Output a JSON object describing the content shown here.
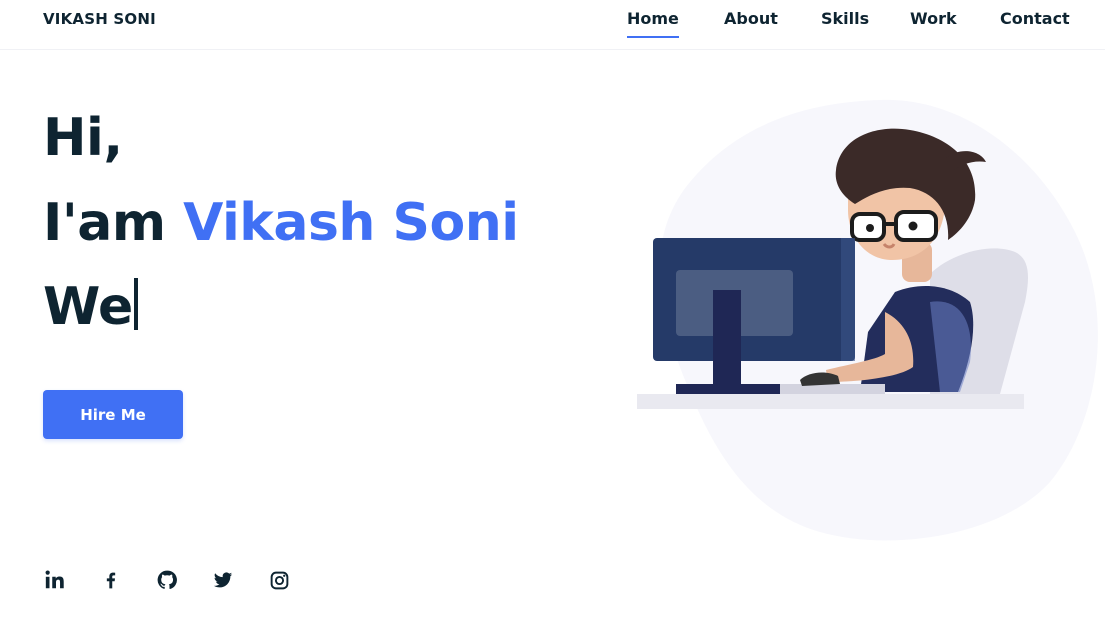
{
  "header": {
    "logo": "VIKASH SONI",
    "nav": [
      {
        "label": "Home",
        "active": true
      },
      {
        "label": "About",
        "active": false
      },
      {
        "label": "Skills",
        "active": false
      },
      {
        "label": "Work",
        "active": false
      },
      {
        "label": "Contact",
        "active": false
      }
    ]
  },
  "hero": {
    "greeting": "Hi,",
    "intro_prefix": "I'am ",
    "name": "Vikash Soni",
    "typed_text": "We",
    "cta_label": "Hire Me"
  },
  "socials": [
    {
      "icon": "linkedin-icon"
    },
    {
      "icon": "facebook-icon"
    },
    {
      "icon": "github-icon"
    },
    {
      "icon": "twitter-icon"
    },
    {
      "icon": "instagram-icon"
    }
  ],
  "colors": {
    "accent": "#4070f4",
    "text": "#0e2431",
    "blob": "#f7f7fc"
  }
}
